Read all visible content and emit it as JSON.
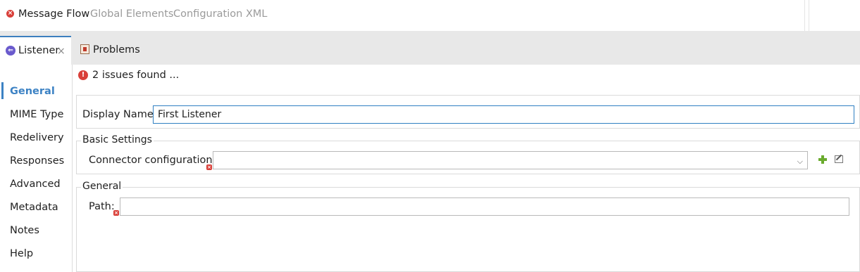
{
  "editor_tabs": {
    "message_flow": "Message Flow",
    "global_elements": "Global Elements",
    "configuration_xml": "Configuration XML"
  },
  "view_tabs": {
    "listener": "Listener",
    "problems": "Problems"
  },
  "sidebar": {
    "items": [
      {
        "label": "General",
        "active": true
      },
      {
        "label": "MIME Type"
      },
      {
        "label": "Redelivery"
      },
      {
        "label": "Responses"
      },
      {
        "label": "Advanced"
      },
      {
        "label": "Metadata"
      },
      {
        "label": "Notes"
      },
      {
        "label": "Help"
      }
    ]
  },
  "issues": {
    "text": "2 issues found ..."
  },
  "display_name": {
    "label": "Display Name:",
    "value": "First Listener"
  },
  "basic_settings": {
    "title": "Basic Settings",
    "connector_label": "Connector configuration:",
    "connector_value": ""
  },
  "general_group": {
    "title": "General",
    "path_label": "Path:",
    "path_value": ""
  },
  "colors": {
    "accent": "#3c82c4",
    "error": "#d9403a",
    "add_green": "#6aab2e"
  },
  "icons": {
    "error": "error-icon",
    "listener": "listener-icon",
    "problems": "problems-icon",
    "add": "add-plus-icon",
    "edit": "edit-icon"
  }
}
